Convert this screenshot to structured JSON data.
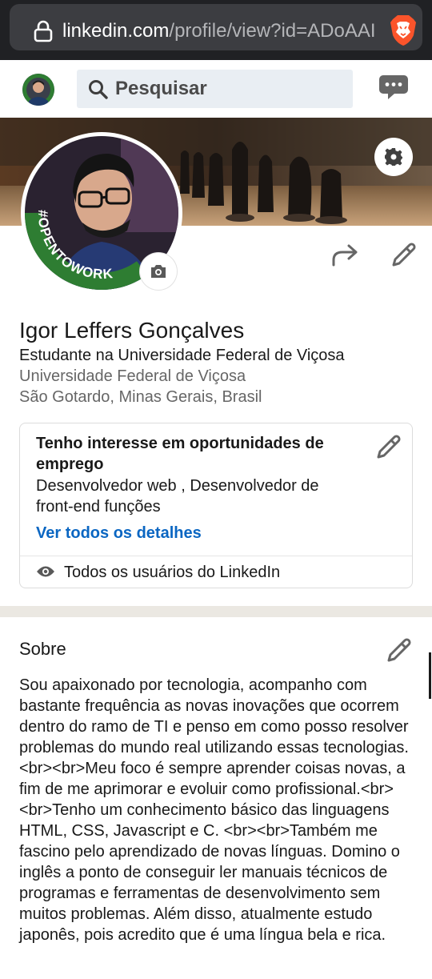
{
  "browser": {
    "url_host": "linkedin.com",
    "url_path": "/profile/view?id=ADoAAI"
  },
  "header": {
    "search_placeholder": "Pesquisar"
  },
  "profile": {
    "name": "Igor Leffers Gonçalves",
    "headline": "Estudante na Universidade Federal de Viçosa",
    "school": "Universidade Federal de Viçosa",
    "location": "São Gotardo, Minas Gerais, Brasil",
    "photo_frame_text": "#OPENTOWORK"
  },
  "open_to_work": {
    "title": "Tenho interesse em oportunidades de emprego",
    "roles": "Desenvolvedor web , Desenvolvedor de front-end funções",
    "details_link": "Ver todos os detalhes",
    "visibility": "Todos os usuários do LinkedIn"
  },
  "about": {
    "title": "Sobre",
    "text": "Sou apaixonado por tecnologia, acompanho com bastante frequência as novas inovações que ocorrem dentro do ramo de TI e penso em como posso resolver problemas do mundo real utilizando essas tecnologias.<br><br>Meu foco é sempre aprender coisas novas, a fim de me aprimorar e evoluir como profissional.<br><br>Tenho um conhecimento básico das linguagens HTML, CSS, Javascript e C. <br><br>Também me fascino pelo aprendizado de novas línguas. Domino o inglês a ponto de conseguir ler manuais técnicos de programas e ferramentas de desenvolvimento sem muitos problemas. Além disso, atualmente estudo japonês, pois acredito que é uma língua bela e rica."
  },
  "colors": {
    "link_blue": "#0a66c2",
    "opentowork_green": "#2e7d32",
    "section_gap": "#ebe8e2"
  }
}
